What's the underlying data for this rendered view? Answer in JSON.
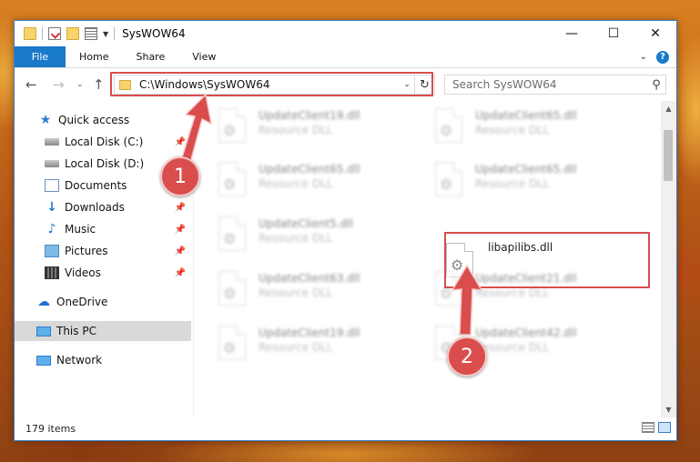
{
  "window": {
    "title": "SysWOW64",
    "controls": {
      "minimize": "—",
      "maximize": "☐",
      "close": "✕"
    }
  },
  "ribbon": {
    "tabs": [
      "File",
      "Home",
      "Share",
      "View"
    ]
  },
  "address": {
    "path": "C:\\Windows\\SysWOW64",
    "search_placeholder": "Search SysWOW64"
  },
  "sidebar": {
    "items": [
      {
        "label": "Quick access",
        "icon": "star-icon"
      },
      {
        "label": "Local Disk (C:)",
        "icon": "drive-icon"
      },
      {
        "label": "Local Disk (D:)",
        "icon": "drive-icon"
      },
      {
        "label": "Documents",
        "icon": "documents-icon"
      },
      {
        "label": "Downloads",
        "icon": "download-icon"
      },
      {
        "label": "Music",
        "icon": "music-icon"
      },
      {
        "label": "Pictures",
        "icon": "pictures-icon"
      },
      {
        "label": "Videos",
        "icon": "videos-icon"
      },
      {
        "label": "OneDrive",
        "icon": "cloud-icon"
      },
      {
        "label": "This PC",
        "icon": "computer-icon"
      },
      {
        "label": "Network",
        "icon": "network-icon"
      }
    ]
  },
  "files": [
    {
      "name": "UpdateClient19.dll",
      "type": "Resource DLL"
    },
    {
      "name": "UpdateClient65.dll",
      "type": "Resource DLL"
    },
    {
      "name": "UpdateClient65.dll",
      "type": "Resource DLL"
    },
    {
      "name": "UpdateClient65.dll",
      "type": "Resource DLL"
    },
    {
      "name": "UpdateClient5.dll",
      "type": "Resource DLL"
    },
    {
      "name": "libapilibs.dll",
      "type": ""
    },
    {
      "name": "UpdateClient63.dll",
      "type": "Resource DLL"
    },
    {
      "name": "UpdateClient21.dll",
      "type": "Resource DLL"
    },
    {
      "name": "UpdateClient19.dll",
      "type": "Resource DLL"
    },
    {
      "name": "UpdateClient42.dll",
      "type": "Resource DLL"
    }
  ],
  "status": {
    "item_count": "179 items"
  },
  "annotations": {
    "step1": "1",
    "step2": "2",
    "color": "#d94d4d"
  }
}
